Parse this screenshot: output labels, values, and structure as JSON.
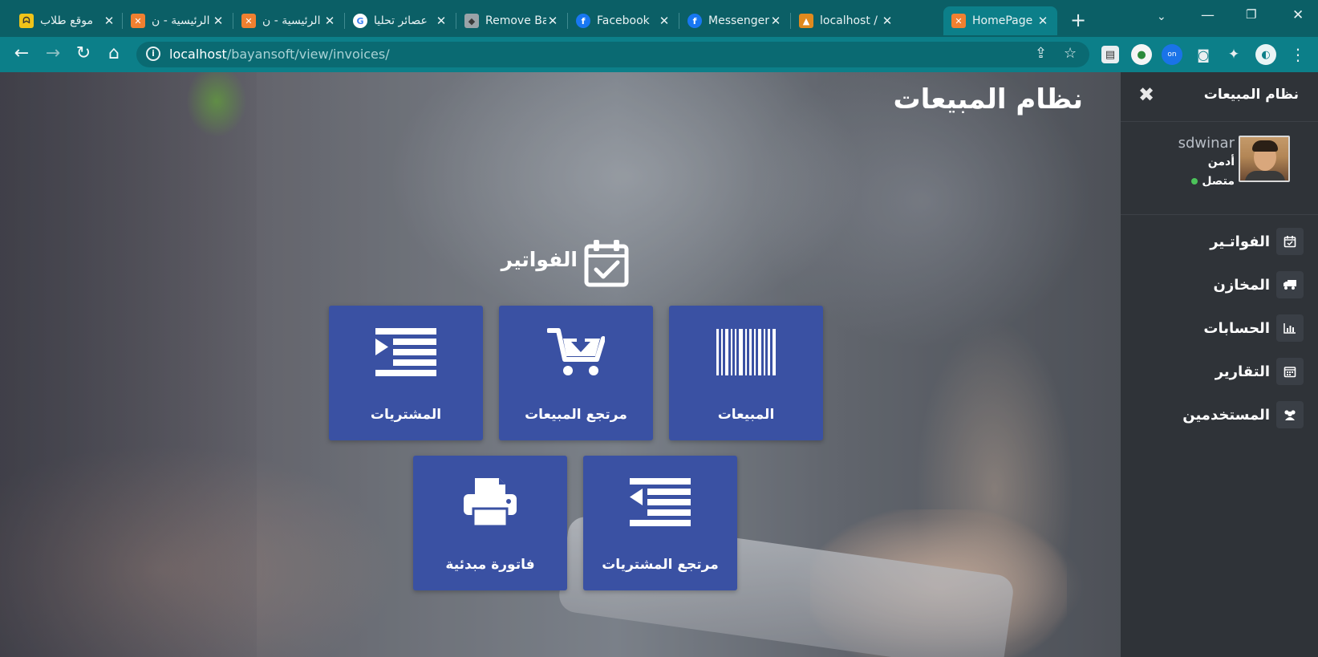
{
  "browser": {
    "tabs": [
      {
        "title": "موقع طلاب",
        "favicon": "pacman-icon",
        "color": "#f0c419"
      },
      {
        "title": "الرئيسية - ن",
        "favicon": "xampp-icon",
        "color": "#f08030"
      },
      {
        "title": "الرئيسية - ن",
        "favicon": "xampp-icon",
        "color": "#f08030"
      },
      {
        "title": "عصائر تحليا",
        "favicon": "google-icon",
        "color": "#ffffff"
      },
      {
        "title": "Remove Ba",
        "favicon": "layers-icon",
        "color": "#9aa3a8"
      },
      {
        "title": "Facebook",
        "favicon": "facebook-icon",
        "color": "#1877f2"
      },
      {
        "title": "Messenger",
        "favicon": "facebook-icon",
        "color": "#1877f2"
      },
      {
        "title": "localhost /",
        "favicon": "phpmyadmin-icon",
        "color": "#e08a1e"
      },
      {
        "title": "HomePage",
        "favicon": "xampp-icon",
        "color": "#f08030"
      }
    ],
    "active_tab": 8,
    "url_host": "localhost",
    "url_path": "/bayansoft/view/invoices/"
  },
  "page": {
    "title": "نظام المبيعات",
    "section_title": "الفواتير",
    "tiles_row1": [
      {
        "label": "المشتريات",
        "icon": "list-indent-icon"
      },
      {
        "label": "مرتجع المبيعات",
        "icon": "cart-download-icon"
      },
      {
        "label": "المبيعات",
        "icon": "barcode-icon"
      }
    ],
    "tiles_row2": [
      {
        "label": "فاتورة مبدئية",
        "icon": "printer-icon"
      },
      {
        "label": "مرتجع المشتريات",
        "icon": "list-outdent-icon"
      }
    ],
    "tile_color": "#3a51a3"
  },
  "sidebar": {
    "title": "نظام المبيعات",
    "user": {
      "name": "sdwinar",
      "role": "أدمن",
      "status": "متصل"
    },
    "items": [
      {
        "label": "الفواتـير",
        "icon": "calendar-check-icon"
      },
      {
        "label": "المخازن",
        "icon": "truck-icon"
      },
      {
        "label": "الحسابات",
        "icon": "bar-chart-icon"
      },
      {
        "label": "التقارير",
        "icon": "calendar-icon"
      },
      {
        "label": "المستخدمين",
        "icon": "users-icon"
      }
    ]
  }
}
